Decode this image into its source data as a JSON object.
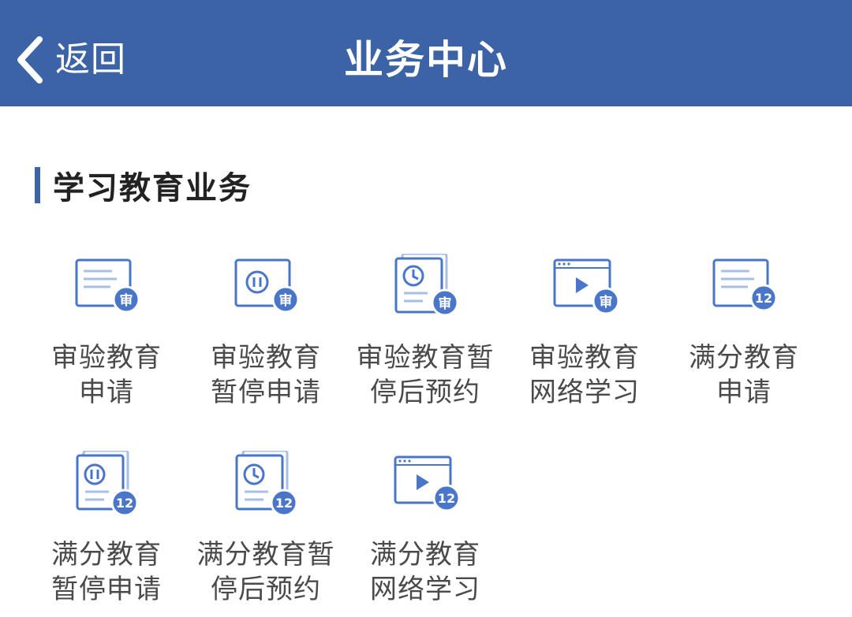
{
  "header": {
    "back_label": "返回",
    "title": "业务中心"
  },
  "section": {
    "title": "学习教育业务"
  },
  "colors": {
    "brand": "#3b63a6",
    "icon_blue": "#4a76c9"
  },
  "items": [
    {
      "line1": "审验教育",
      "line2": "申请",
      "icon": "document-review-icon",
      "badge": "审"
    },
    {
      "line1": "审验教育",
      "line2": "暂停申请",
      "icon": "pause-review-icon",
      "badge": "审"
    },
    {
      "line1": "审验教育暂",
      "line2": "停后预约",
      "icon": "clock-review-icon",
      "badge": "审"
    },
    {
      "line1": "审验教育",
      "line2": "网络学习",
      "icon": "video-review-icon",
      "badge": "审"
    },
    {
      "line1": "满分教育",
      "line2": "申请",
      "icon": "document-full-score-icon",
      "badge": "12"
    },
    {
      "line1": "满分教育",
      "line2": "暂停申请",
      "icon": "pause-full-score-icon",
      "badge": "12"
    },
    {
      "line1": "满分教育暂",
      "line2": "停后预约",
      "icon": "clock-full-score-icon",
      "badge": "12"
    },
    {
      "line1": "满分教育",
      "line2": "网络学习",
      "icon": "video-full-score-icon",
      "badge": "12"
    }
  ]
}
